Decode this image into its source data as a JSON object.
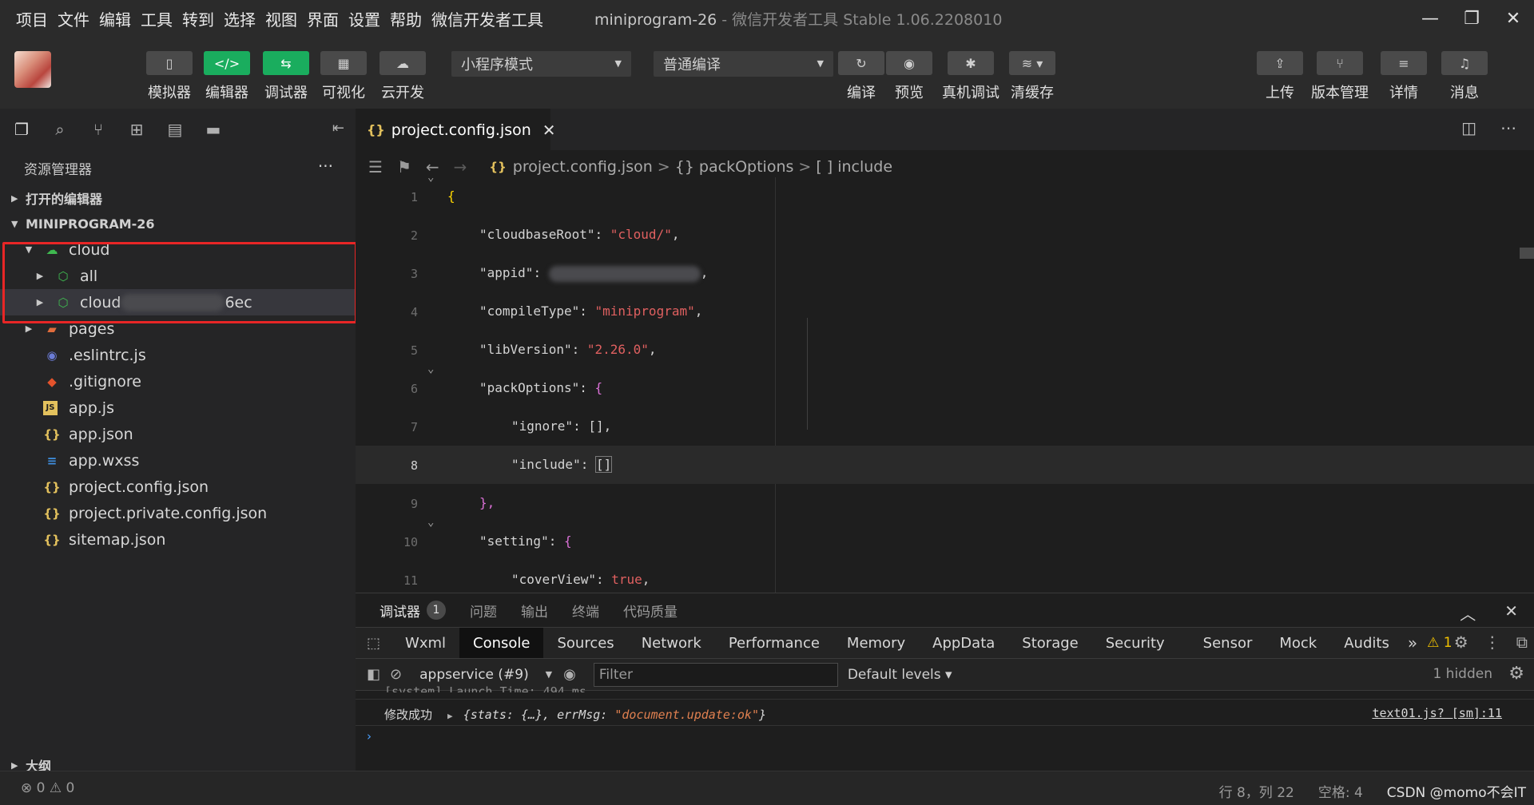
{
  "menu": [
    "项目",
    "文件",
    "编辑",
    "工具",
    "转到",
    "选择",
    "视图",
    "界面",
    "设置",
    "帮助",
    "微信开发者工具"
  ],
  "window": {
    "project": "miniprogram-26",
    "subtitle": " - 微信开发者工具 Stable 1.06.2208010",
    "minimize": "—",
    "restore": "❐",
    "close": "✕"
  },
  "toolbar": {
    "simulator": "模拟器",
    "editor": "编辑器",
    "debugger": "调试器",
    "visual": "可视化",
    "cloud": "云开发",
    "mode_select": "小程序模式",
    "compile_select": "普通编译",
    "compile": "编译",
    "preview": "预览",
    "remote_debug": "真机调试",
    "clear_cache": "清缓存",
    "upload": "上传",
    "version": "版本管理",
    "details": "详情",
    "messages": "消息"
  },
  "sidebar": {
    "title": "资源管理器",
    "more": "···",
    "open_editors": "打开的编辑器",
    "project": "MINIPROGRAM-26",
    "outline": "大纲",
    "tree": {
      "cloud": "cloud",
      "all": "all",
      "cloud_env_prefix": "cloud",
      "cloud_env_suffix": "6ec",
      "pages": "pages",
      "eslintrc": ".eslintrc.js",
      "gitignore": ".gitignore",
      "appjs": "app.js",
      "appjson": "app.json",
      "appwxss": "app.wxss",
      "projectconfig": "project.config.json",
      "projectprivate": "project.private.config.json",
      "sitemap": "sitemap.json"
    }
  },
  "editor": {
    "tab_name": "project.config.json",
    "tab_close": "✕",
    "breadcrumb": {
      "file": "project.config.json",
      "obj": "{} packOptions",
      "arr": "[ ] include"
    },
    "lines": [
      {
        "n": "1"
      },
      {
        "n": "2"
      },
      {
        "n": "3"
      },
      {
        "n": "4"
      },
      {
        "n": "5"
      },
      {
        "n": "6"
      },
      {
        "n": "7"
      },
      {
        "n": "8"
      },
      {
        "n": "9"
      },
      {
        "n": "10"
      },
      {
        "n": "11"
      }
    ],
    "code": {
      "l1": "{",
      "l2_key": "\"cloudbaseRoot\"",
      "l2_val": "\"cloud/\"",
      "l3_key": "\"appid\"",
      "l4_key": "\"compileType\"",
      "l4_val": "\"miniprogram\"",
      "l5_key": "\"libVersion\"",
      "l5_val": "\"2.26.0\"",
      "l6_key": "\"packOptions\"",
      "l7_key": "\"ignore\"",
      "l7_val": "[]",
      "l8_key": "\"include\"",
      "l8_val": "[]",
      "l9": "},",
      "l10_key": "\"setting\"",
      "l11_key": "\"coverView\"",
      "l11_val": "true"
    }
  },
  "panel": {
    "tabs": {
      "debugger": "调试器",
      "badge": "1",
      "problems": "问题",
      "output": "输出",
      "terminal": "终端",
      "quality": "代码质量"
    },
    "devtools": [
      "Wxml",
      "Console",
      "Sources",
      "Network",
      "Performance",
      "Memory",
      "AppData",
      "Storage",
      "Security",
      "Sensor",
      "Mock",
      "Audits"
    ],
    "overflow": "»",
    "warn_count": "1",
    "context": "appservice (#9)",
    "filter_placeholder": "Filter",
    "levels": "Default levels ▾",
    "hidden": "1 hidden",
    "log": {
      "label": "修改成功",
      "obj_open": "{stats: {…}, errMsg: ",
      "obj_str": "\"document.update:ok\"",
      "obj_close": "}",
      "source": "text01.js? [sm]:11"
    }
  },
  "status": {
    "errors": "⊗ 0 ⚠ 0",
    "cursor": "行 8，列 22",
    "spaces": "空格: 4",
    "watermark": "CSDN @momo不会IT"
  },
  "colors": {
    "accent_green": "#1aad5e",
    "highlight_red": "#e82626",
    "string_red": "#e06060"
  }
}
